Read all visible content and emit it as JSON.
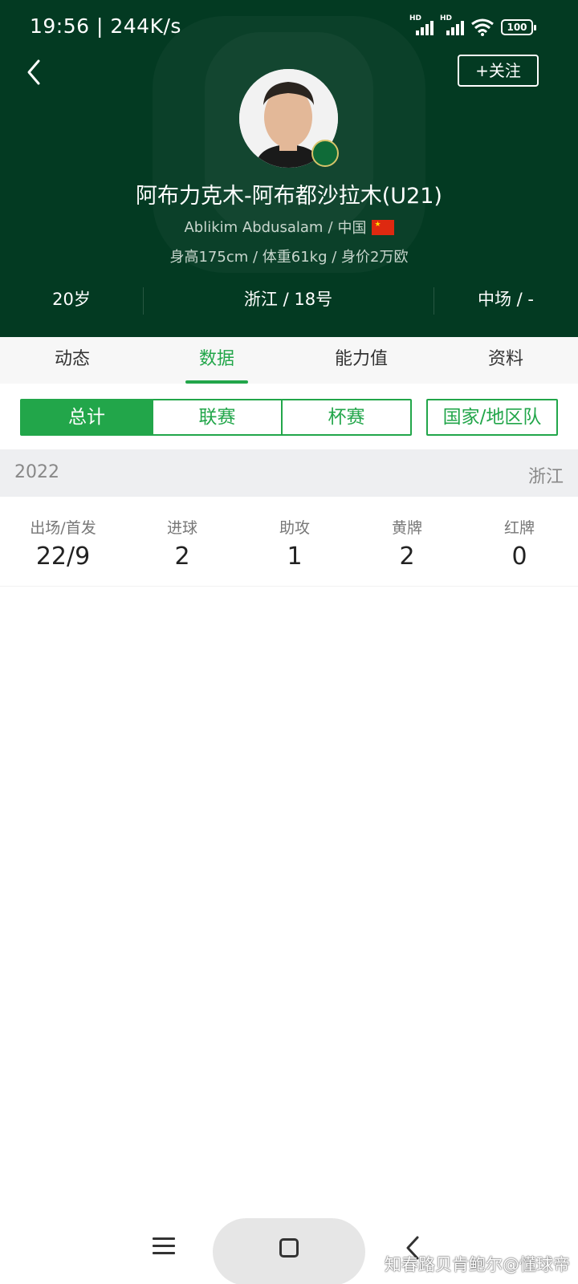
{
  "status_bar": {
    "time": "19:56",
    "speed": "244K/s",
    "sim1_label": "HD",
    "sim2_label": "HD",
    "battery": "100"
  },
  "header": {
    "follow_label": "+关注",
    "player_name": "阿布力克木-阿布都沙拉木(U21)",
    "english_name": "Ablikim Abdusalam",
    "nationality": "中国",
    "meta": "身高175cm / 体重61kg / 身价2万欧",
    "age": "20岁",
    "club_number": "浙江 / 18号",
    "position": "中场 / -",
    "accent_color": "#033a22"
  },
  "tabs": [
    {
      "label": "动态"
    },
    {
      "label": "数据"
    },
    {
      "label": "能力值"
    },
    {
      "label": "资料"
    }
  ],
  "active_tab": "数据",
  "filters": {
    "total": "总计",
    "league": "联赛",
    "cup": "杯赛",
    "national": "国家/地区队",
    "active": "总计",
    "accent_color": "#22a64a"
  },
  "season": {
    "year": "2022",
    "team": "浙江"
  },
  "stats": [
    {
      "label": "出场/首发",
      "value": "22/9"
    },
    {
      "label": "进球",
      "value": "2"
    },
    {
      "label": "助攻",
      "value": "1"
    },
    {
      "label": "黄牌",
      "value": "2"
    },
    {
      "label": "红牌",
      "value": "0"
    }
  ],
  "watermark": "知春路贝肯鲍尔@懂球帝"
}
